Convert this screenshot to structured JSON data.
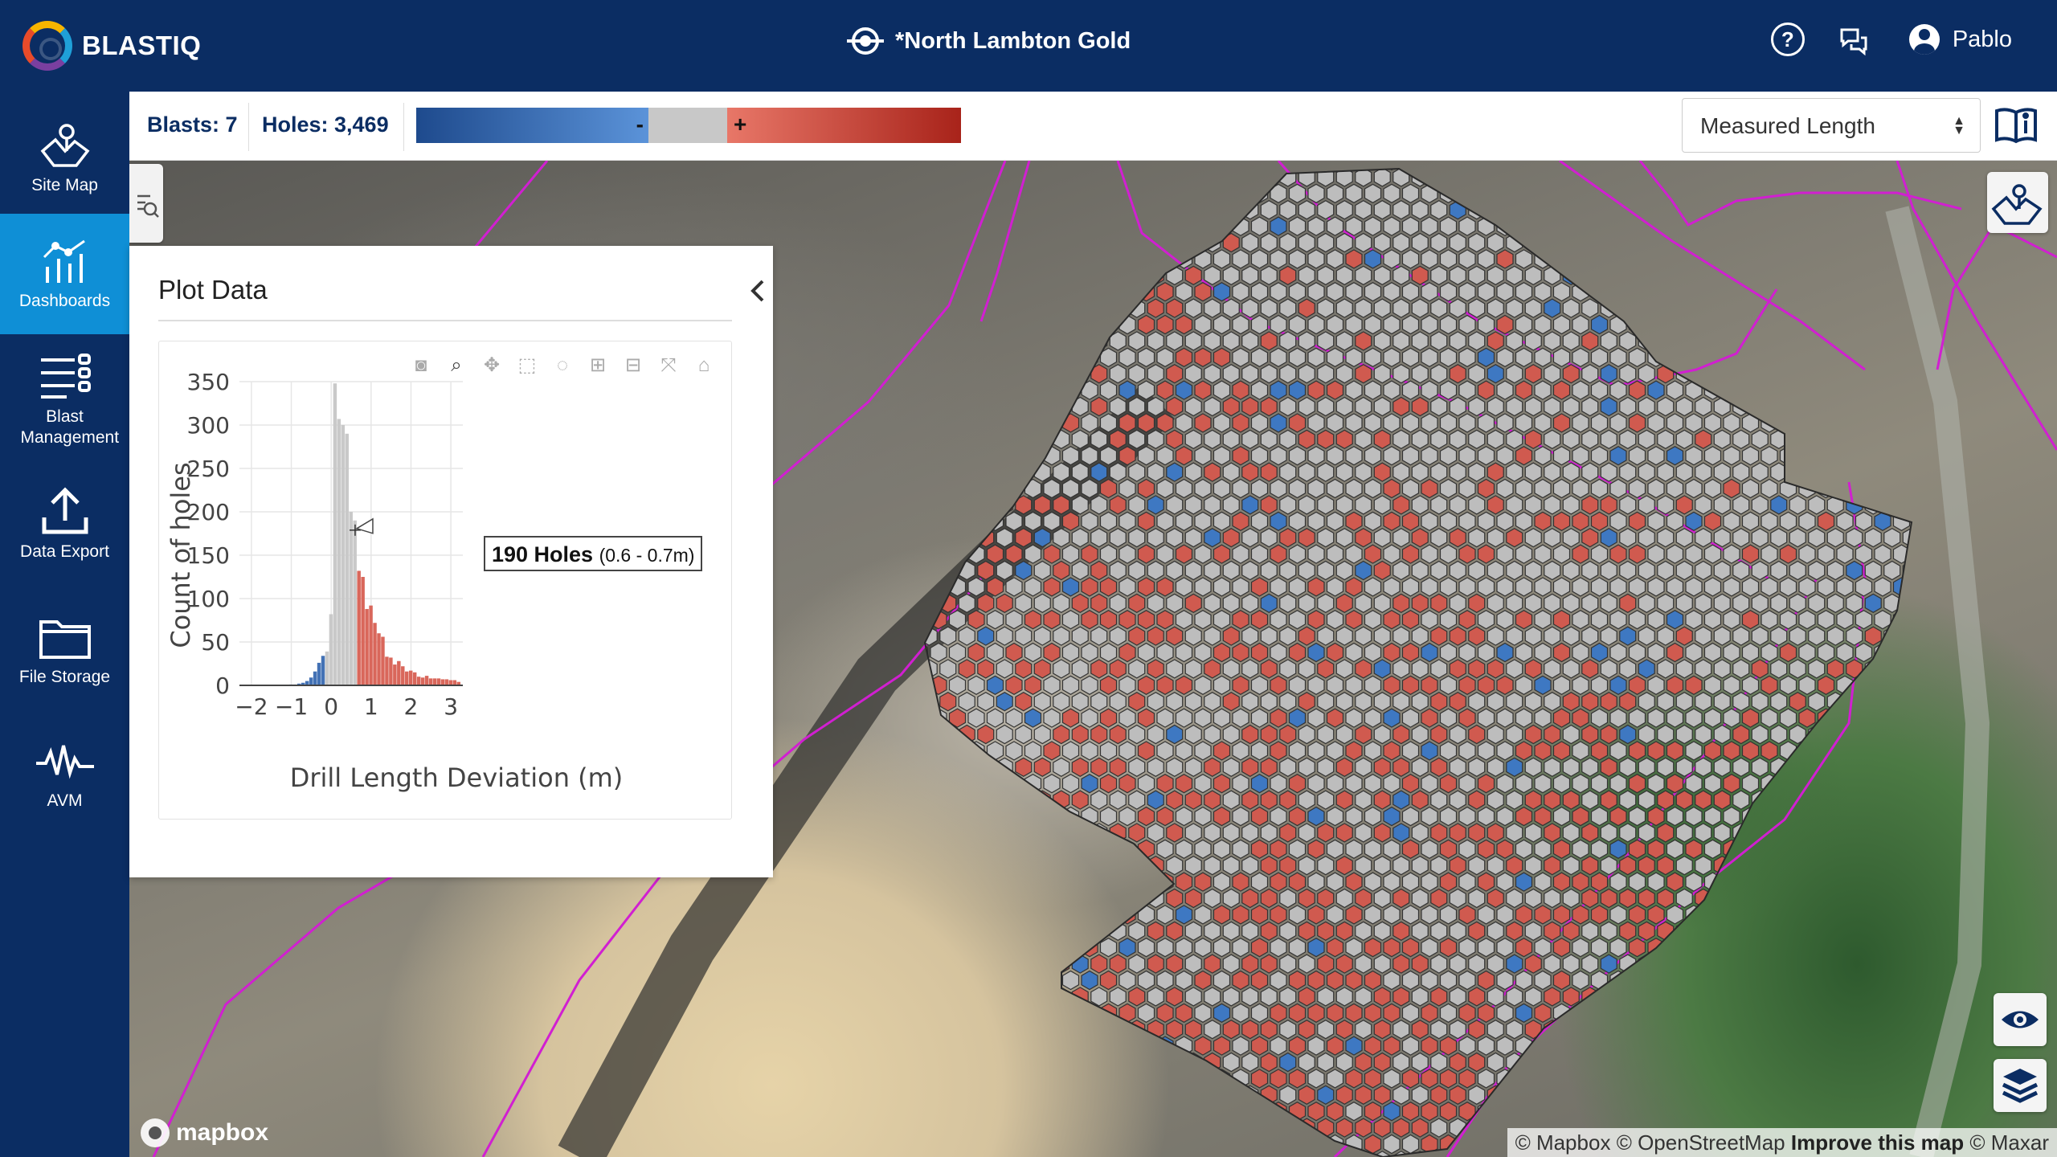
{
  "header": {
    "logo_text": "BLASTIQ",
    "site_name": "*North Lambton Gold",
    "help_label": "?",
    "user_name": "Pablo"
  },
  "sidebar": {
    "items": [
      {
        "label": "Site Map",
        "icon": "map-icon",
        "active": false
      },
      {
        "label": "Dashboards",
        "icon": "dashboard-icon",
        "active": true
      },
      {
        "label": "Blast Management",
        "icon": "list-icon",
        "active": false
      },
      {
        "label": "Data Export",
        "icon": "upload-icon",
        "active": false
      },
      {
        "label": "File Storage",
        "icon": "folder-icon",
        "active": false
      },
      {
        "label": "AVM",
        "icon": "waveform-icon",
        "active": false
      }
    ]
  },
  "toolbar": {
    "blasts": "Blasts: 7",
    "holes": "Holes: 3,469",
    "legend": {
      "minus": "-",
      "plus": "+",
      "colors": {
        "negative_dark": "#1e4a8d",
        "negative_light": "#5b93d9",
        "neutral": "#c8c8c8",
        "positive_light": "#e87768",
        "positive_dark": "#a8231a"
      }
    },
    "select_value": "Measured Length"
  },
  "panel": {
    "title": "Plot Data",
    "tooltip": {
      "count": "190 Holes",
      "range": "(0.6 - 0.7m)"
    }
  },
  "map": {
    "attribution": {
      "mapbox": "© Mapbox",
      "osm": "© OpenStreetMap",
      "improve": "Improve this map",
      "maxar": "© Maxar"
    },
    "logo": "mapbox",
    "colors": {
      "hole_red": "#d05a4f",
      "hole_grey": "#bdbdbd",
      "hole_blue": "#3e78c2",
      "boundary": "#d11fd1"
    }
  },
  "chart_data": {
    "type": "bar",
    "xlabel": "Drill Length Deviation (m)",
    "ylabel": "Count of holes",
    "xlim": [
      -2.3,
      3.3
    ],
    "ylim": [
      0,
      350
    ],
    "x_ticks": [
      "−2",
      "−1",
      "0",
      "1",
      "2",
      "3"
    ],
    "y_ticks": [
      "0",
      "50",
      "100",
      "150",
      "200",
      "250",
      "300",
      "350"
    ],
    "bin_width": 0.1,
    "bars": [
      {
        "x": -1.0,
        "value": 1,
        "group": "negative"
      },
      {
        "x": -0.9,
        "value": 1,
        "group": "negative"
      },
      {
        "x": -0.8,
        "value": 2,
        "group": "negative"
      },
      {
        "x": -0.7,
        "value": 3,
        "group": "negative"
      },
      {
        "x": -0.6,
        "value": 5,
        "group": "negative"
      },
      {
        "x": -0.5,
        "value": 9,
        "group": "negative"
      },
      {
        "x": -0.4,
        "value": 16,
        "group": "negative"
      },
      {
        "x": -0.3,
        "value": 26,
        "group": "negative"
      },
      {
        "x": -0.2,
        "value": 34,
        "group": "negative"
      },
      {
        "x": -0.1,
        "value": 39,
        "group": "neutral"
      },
      {
        "x": 0.0,
        "value": 82,
        "group": "neutral"
      },
      {
        "x": 0.1,
        "value": 348,
        "group": "neutral"
      },
      {
        "x": 0.2,
        "value": 307,
        "group": "neutral"
      },
      {
        "x": 0.3,
        "value": 300,
        "group": "neutral"
      },
      {
        "x": 0.4,
        "value": 290,
        "group": "neutral"
      },
      {
        "x": 0.5,
        "value": 200,
        "group": "neutral"
      },
      {
        "x": 0.6,
        "value": 190,
        "group": "neutral"
      },
      {
        "x": 0.7,
        "value": 132,
        "group": "positive"
      },
      {
        "x": 0.8,
        "value": 125,
        "group": "positive"
      },
      {
        "x": 0.9,
        "value": 88,
        "group": "positive"
      },
      {
        "x": 1.0,
        "value": 92,
        "group": "positive"
      },
      {
        "x": 1.1,
        "value": 72,
        "group": "positive"
      },
      {
        "x": 1.2,
        "value": 60,
        "group": "positive"
      },
      {
        "x": 1.3,
        "value": 56,
        "group": "positive"
      },
      {
        "x": 1.4,
        "value": 33,
        "group": "positive"
      },
      {
        "x": 1.5,
        "value": 32,
        "group": "positive"
      },
      {
        "x": 1.6,
        "value": 24,
        "group": "positive"
      },
      {
        "x": 1.7,
        "value": 28,
        "group": "positive"
      },
      {
        "x": 1.8,
        "value": 22,
        "group": "positive"
      },
      {
        "x": 1.9,
        "value": 16,
        "group": "positive"
      },
      {
        "x": 2.0,
        "value": 17,
        "group": "positive"
      },
      {
        "x": 2.1,
        "value": 15,
        "group": "positive"
      },
      {
        "x": 2.2,
        "value": 10,
        "group": "positive"
      },
      {
        "x": 2.3,
        "value": 9,
        "group": "positive"
      },
      {
        "x": 2.4,
        "value": 11,
        "group": "positive"
      },
      {
        "x": 2.5,
        "value": 8,
        "group": "positive"
      },
      {
        "x": 2.6,
        "value": 8,
        "group": "positive"
      },
      {
        "x": 2.7,
        "value": 8,
        "group": "positive"
      },
      {
        "x": 2.8,
        "value": 7,
        "group": "positive"
      },
      {
        "x": 2.9,
        "value": 7,
        "group": "positive"
      },
      {
        "x": 3.0,
        "value": 6,
        "group": "positive"
      },
      {
        "x": 3.1,
        "value": 6,
        "group": "positive"
      },
      {
        "x": 3.2,
        "value": 4,
        "group": "positive"
      }
    ],
    "colors": {
      "negative": "#4372b5",
      "neutral": "#c9c9c9",
      "positive": "#d9675b"
    },
    "hover_bar_x": 0.6,
    "grid": true
  }
}
